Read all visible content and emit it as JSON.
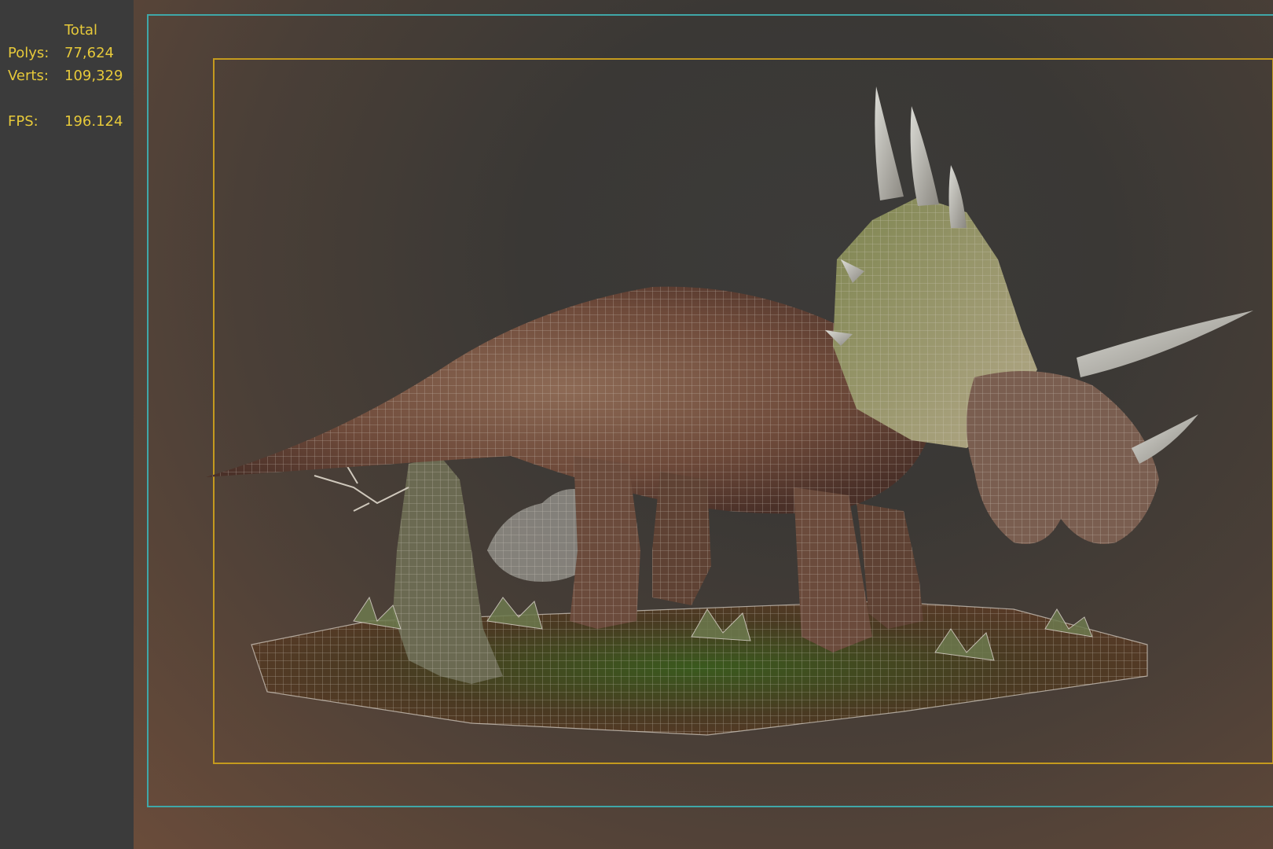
{
  "stats": {
    "header": "Total",
    "rows": [
      {
        "label": "Polys:",
        "value": "77,624"
      },
      {
        "label": "Verts:",
        "value": "109,329"
      },
      {
        "label": "FPS:",
        "value": "196.124"
      }
    ]
  },
  "colors": {
    "stats_text": "#e6c93a",
    "panel_bg": "#3b3b3b",
    "frame_outer": "#3fa7a8",
    "frame_safe": "#c49a1e"
  },
  "scene": {
    "subject": "triceratops-wireframe-model"
  }
}
